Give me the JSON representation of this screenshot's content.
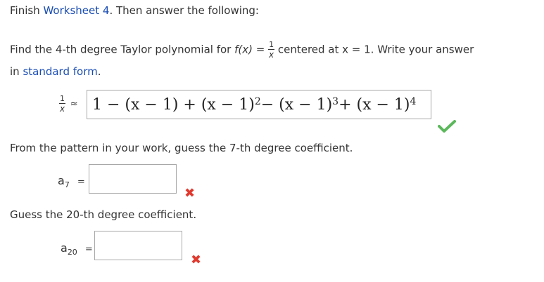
{
  "instruction": {
    "prefix": "Finish ",
    "worksheet_link": "Worksheet 4",
    "suffix": ". Then answer the following:"
  },
  "question": {
    "line1_a": "Find the 4-th degree Taylor polynomial for ",
    "func": "f(x)",
    "equals": " = ",
    "frac_num": "1",
    "frac_den": "x",
    "line1_b": " centered at ",
    "center_expr": "x = 1",
    "line1_c": ". Write your answer",
    "line2_a": "in ",
    "standard_form_link": "standard form",
    "line2_b": "."
  },
  "answer": {
    "lhs_num": "1",
    "lhs_den": "x",
    "approx": "≈",
    "p0": "1 − (x − 1) + (x − 1)",
    "e1": "2",
    "p1": " − (x − 1)",
    "e2": "3",
    "p2": " + (x − 1)",
    "e3": "4",
    "status_icon": "check-icon"
  },
  "pattern_prompt": "From the pattern in your work, guess the 7-th degree coefficient.",
  "a7": {
    "label_base": "a",
    "label_sub": "7",
    "equals": "=",
    "value": "",
    "status_icon": "x-icon"
  },
  "guess20_prompt": "Guess the 20-th degree coefficient.",
  "a20": {
    "label_base": "a",
    "label_sub": "20",
    "equals": "=",
    "value": "",
    "status_icon": "x-icon"
  },
  "colors": {
    "link": "#1a4db3",
    "correct": "#5cb85c",
    "incorrect": "#e03a2f"
  }
}
